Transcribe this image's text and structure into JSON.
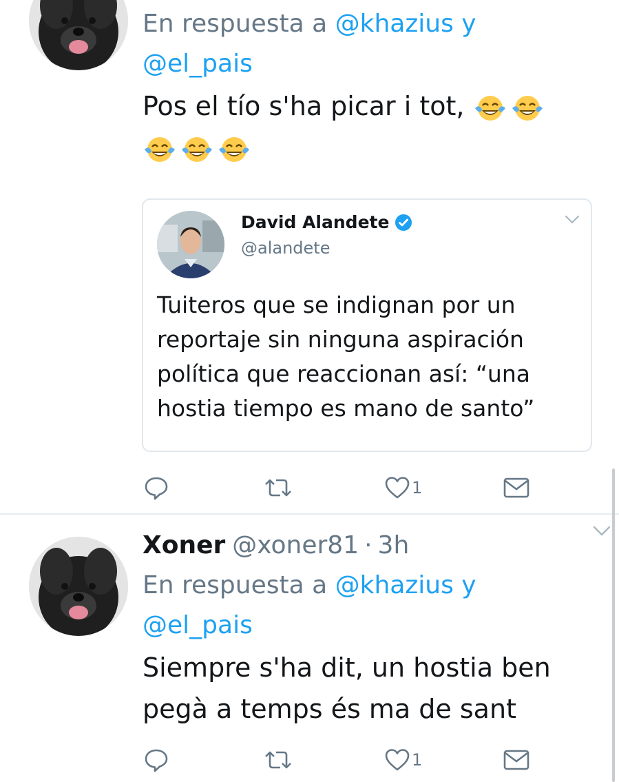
{
  "colors": {
    "link": "#1da1f2",
    "secondary_text": "#657786",
    "primary_text": "#14171a",
    "border": "#e1e8ed"
  },
  "tweets": [
    {
      "reply_prefix": "En respuesta a ",
      "reply_user_1": "@khazius",
      "reply_joiner": " y",
      "reply_user_2": "@el_pais",
      "text": "Pos el tío s'ha picar i tot,",
      "emoji": [
        "face-with-tears-of-joy-icon",
        "face-with-tears-of-joy-icon",
        "face-with-tears-of-joy-icon",
        "face-with-tears-of-joy-icon",
        "face-with-tears-of-joy-icon"
      ],
      "quoted": {
        "name": "David Alandete",
        "handle": "@alandete",
        "verified": true,
        "text": "Tuiteros que se indignan por un reportaje sin ninguna aspiración política que reaccionan así: “una hostia tiempo es mano de santo”"
      },
      "actions": {
        "like_count": "1"
      }
    },
    {
      "name": "Xoner",
      "handle": "@xoner81",
      "separator": "·",
      "time": "3h",
      "reply_prefix": "En respuesta a ",
      "reply_user_1": "@khazius",
      "reply_joiner": " y",
      "reply_user_2": "@el_pais",
      "text": "Siempre s'ha dit, un hostia ben pegà a temps és ma de sant",
      "actions": {
        "like_count": "1"
      }
    }
  ]
}
